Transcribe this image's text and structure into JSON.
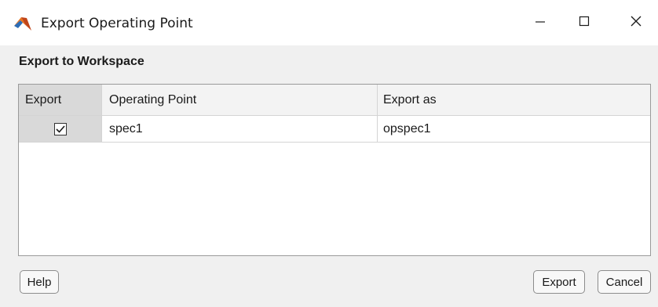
{
  "window": {
    "title": "Export Operating Point",
    "controls": [
      "minimize-icon",
      "maximize-icon",
      "close-icon"
    ],
    "app_icon": "matlab-icon"
  },
  "section": {
    "label": "Export to Workspace"
  },
  "table": {
    "columns": [
      "Export",
      "Operating Point",
      "Export as"
    ],
    "rows": [
      {
        "export": true,
        "operating_point": "spec1",
        "export_as": "opspec1"
      }
    ]
  },
  "buttons": {
    "help": "Help",
    "export": "Export",
    "cancel": "Cancel"
  },
  "colors": {
    "accent_orange": "#e8731c",
    "header_gray": "#d9d9d9",
    "background": "#f0f0f0"
  }
}
